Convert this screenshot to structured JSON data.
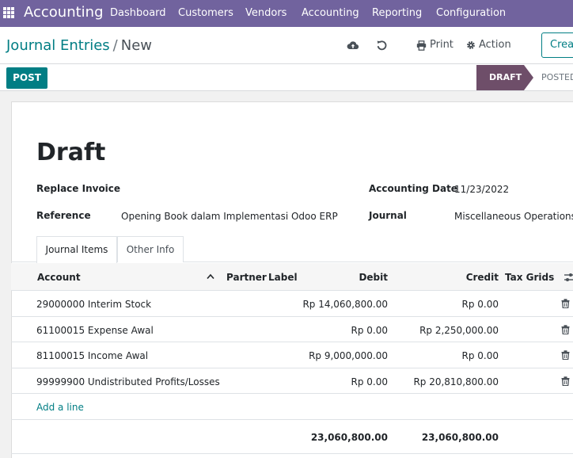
{
  "navbar": {
    "app_title": "Accounting",
    "menu": [
      "Dashboard",
      "Customers",
      "Vendors",
      "Accounting",
      "Reporting",
      "Configuration"
    ]
  },
  "breadcrumb": {
    "parent": "Journal Entries",
    "separator": "/",
    "current": "New"
  },
  "toolbar": {
    "print_label": "Print",
    "action_label": "Action",
    "create_label": "Create"
  },
  "statusbar": {
    "post_label": "POST",
    "draft_label": "DRAFT",
    "posted_label": "POSTED"
  },
  "form": {
    "title": "Draft",
    "replace_invoice_label": "Replace Invoice",
    "reference_label": "Reference",
    "reference_value": "Opening Book dalam Implementasi Odoo ERP",
    "accounting_date_label": "Accounting Date",
    "accounting_date_value": "11/23/2022",
    "journal_label": "Journal",
    "journal_value": "Miscellaneous Operations"
  },
  "tabs": [
    "Journal Items",
    "Other Info"
  ],
  "table": {
    "headers": {
      "account": "Account",
      "partner": "Partner",
      "label": "Label",
      "debit": "Debit",
      "credit": "Credit",
      "tax_grids": "Tax Grids"
    },
    "rows": [
      {
        "account": "29000000 Interim Stock",
        "debit": "Rp 14,060,800.00",
        "credit": "Rp 0.00"
      },
      {
        "account": "61100015 Expense Awal",
        "debit": "Rp 0.00",
        "credit": "Rp 2,250,000.00"
      },
      {
        "account": "81100015 Income Awal",
        "debit": "Rp 9,000,000.00",
        "credit": "Rp 0.00"
      },
      {
        "account": "99999900 Undistributed Profits/Losses",
        "debit": "Rp 0.00",
        "credit": "Rp 20,810,800.00"
      }
    ],
    "add_line": "Add a line",
    "total_debit": "23,060,800.00",
    "total_credit": "23,060,800.00"
  },
  "colors": {
    "navbar": "#71639e",
    "primary": "#017e84",
    "draft_badge": "#6e4e69"
  },
  "icons": [
    "apps-grid-icon",
    "cloud-upload-icon",
    "undo-icon",
    "print-icon",
    "gear-icon",
    "sort-asc-icon",
    "column-settings-icon",
    "trash-icon"
  ]
}
